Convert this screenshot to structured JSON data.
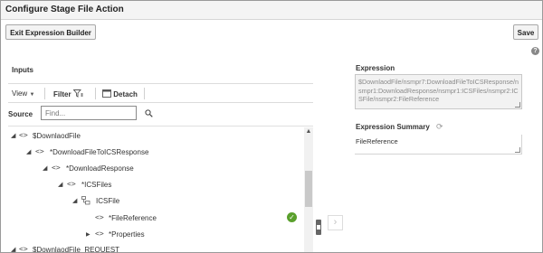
{
  "window": {
    "title": "Configure Stage File Action"
  },
  "buttons": {
    "exit_expression_builder": "Exit Expression Builder",
    "save": "Save"
  },
  "help_icon": "?",
  "inputs": {
    "label": "Inputs",
    "toolbar": {
      "view": "View",
      "filter": "Filter",
      "detach": "Detach"
    },
    "source_label": "Source",
    "find_placeholder": "Find...",
    "tree": [
      {
        "label": "$DownlaodFile",
        "expanded": true,
        "depth": 0
      },
      {
        "label": "*DownloadFileToICSResponse",
        "expanded": true,
        "depth": 1
      },
      {
        "label": "*DownloadResponse",
        "expanded": true,
        "depth": 2
      },
      {
        "label": "*ICSFiles",
        "expanded": true,
        "depth": 3
      },
      {
        "label": "ICSFile",
        "expanded": true,
        "depth": 4,
        "icon": "repeating-element-icon"
      },
      {
        "label": "*FileReference",
        "depth": 5,
        "selected_check": true
      },
      {
        "label": "*Properties",
        "expanded": false,
        "depth": 5
      },
      {
        "label": "$DownlaodFile_REQUEST",
        "expanded": true,
        "depth": 0
      }
    ]
  },
  "expression": {
    "label": "Expression",
    "value": "$DownlaodFile/nsmpr7:DownloadFileToICSResponse/nsmpr1:DownloadResponse/nsmpr1:ICSFiles/nsmpr2:ICSFile/nsmpr2:FileReference"
  },
  "expression_summary": {
    "label": "Expression Summary",
    "value": "FileReference"
  },
  "colors": {
    "check": "#5aa02c",
    "toolbar_bg": "#f4f4f4"
  }
}
